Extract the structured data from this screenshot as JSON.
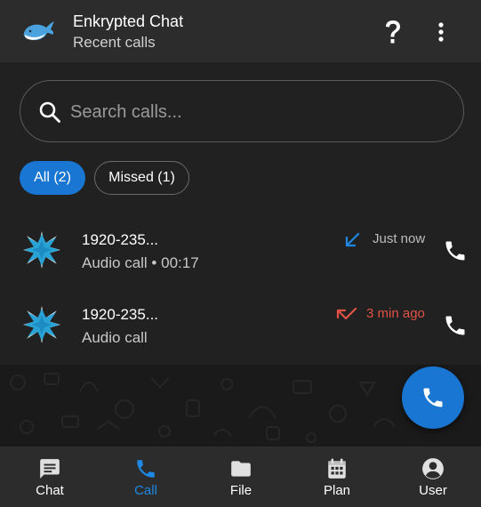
{
  "header": {
    "title": "Enkrypted Chat",
    "subtitle": "Recent calls",
    "help_icon": "help-icon",
    "more_icon": "more-vert-icon"
  },
  "search": {
    "placeholder": "Search calls..."
  },
  "filters": [
    {
      "label": "All (2)",
      "selected": true
    },
    {
      "label": "Missed (1)",
      "selected": false
    }
  ],
  "calls": [
    {
      "name": "1920-235...",
      "detail": "Audio call • 00:17",
      "time": "Just now",
      "direction": "incoming",
      "direction_icon": "arrow-incoming-icon"
    },
    {
      "name": "1920-235...",
      "detail": "Audio call",
      "time": "3 min ago",
      "direction": "missed",
      "direction_icon": "call-missed-icon"
    }
  ],
  "nav": [
    {
      "label": "Chat",
      "icon": "chat-icon",
      "active": false
    },
    {
      "label": "Call",
      "icon": "phone-icon",
      "active": true
    },
    {
      "label": "File",
      "icon": "folder-icon",
      "active": false
    },
    {
      "label": "Plan",
      "icon": "calendar-icon",
      "active": false
    },
    {
      "label": "User",
      "icon": "account-icon",
      "active": false
    }
  ],
  "colors": {
    "accent": "#1976d2",
    "accent_text": "#1e88e5",
    "missed": "#e05245",
    "header_bg": "#2c2c2c",
    "body_bg": "#212121"
  }
}
